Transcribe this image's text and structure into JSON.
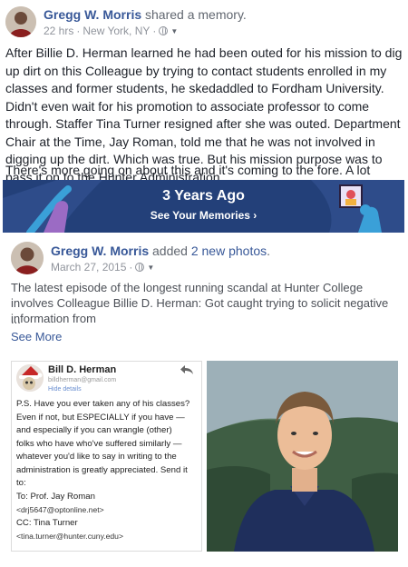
{
  "header": {
    "author": "Gregg W. Morris",
    "action": "shared a memory.",
    "time": "22 hrs",
    "separator": "·",
    "location": "New York, NY",
    "privacy_icon": "globe-icon",
    "menu_icon": "chevron-down-icon"
  },
  "post": {
    "text": "After Billie D. Herman learned he had been outed for his mission to dig up dirt on this Colleague by trying to contact students enrolled in my classes and former students, he skedaddled to Fordham University. Didn't even wait for his promotion to associate professor to come through. Staffer Tina Turner resigned after she was outed. Department Chair at the Time, Jay Roman, told me that he was not involved in digging up the dirt. Which was true. But his mission purpose was to pass it on to the Hunter Administration.",
    "text2": "There's more going on about this and it's coming to the fore. A lot more."
  },
  "memory": {
    "title": "3 Years Ago",
    "link": "See Your Memories ›",
    "colors": {
      "background": "#234079"
    }
  },
  "shared": {
    "author": "Gregg W. Morris",
    "action": "added",
    "photos_link": "2 new photos",
    "period": ".",
    "date": "March 27, 2015",
    "separator": "·",
    "text": "The latest episode of the longest running scandal at Hunter College involves Colleague Billie D. Herman: Got caught trying to solicit negative information from",
    "ellipsis": "...",
    "see_more": "See More"
  },
  "email": {
    "sender": "Bill D. Herman",
    "address": "billdherman@gmail.com",
    "hide_details": "Hide details",
    "lines": [
      "P.S. Have you ever taken any of his classes?",
      "Even if not, but ESPECIALLY if you have —",
      "and especially if you can wrangle (other)",
      "folks who have who've suffered similarly —",
      "whatever you'd like to say in writing to the",
      "administration is greatly appreciated. Send it",
      "to:",
      "To: Prof. Jay Roman",
      "<drj5647@optonline.net>",
      "CC: Tina Turner",
      "<tina.turner@hunter.cuny.edu>"
    ]
  }
}
